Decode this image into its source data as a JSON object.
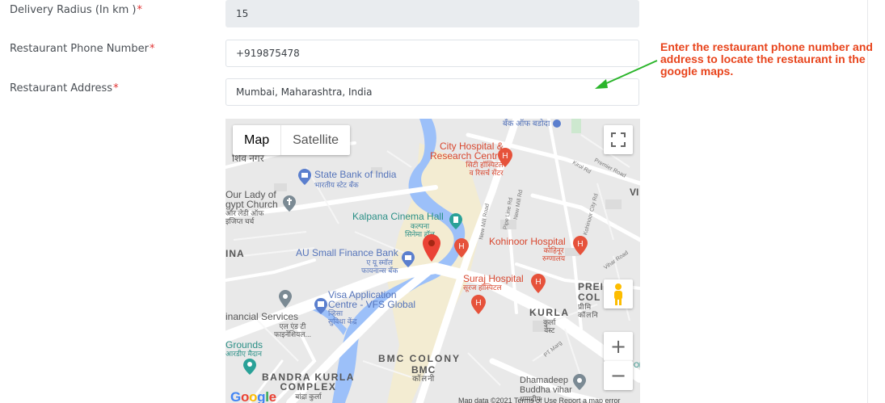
{
  "form": {
    "delivery_radius": {
      "label": "Delivery Radius (In km )",
      "required": "*",
      "value": "15"
    },
    "phone": {
      "label": "Restaurant Phone Number",
      "required": "*",
      "value": "+919875478"
    },
    "address": {
      "label": "Restaurant Address",
      "required": "*",
      "value": "Mumbai, Maharashtra, India"
    }
  },
  "annotation": {
    "text": "Enter the restaurant phone number and address to locate the restaurant in the google maps.",
    "color": "#e8441c",
    "arrow_color": "#2bb52b"
  },
  "map": {
    "type_map": "Map",
    "type_satellite": "Satellite",
    "labels": {
      "bank_baroda": "बँक ऑफ बडोदा",
      "shiv_nagar": "शिव नगर",
      "city_hospital_1": "City Hospital &",
      "city_hospital_2": "Research Centre",
      "city_hospital_3": "सिटी हॉस्पिटल",
      "city_hospital_4": "व रिसर्च सेंटर",
      "sbi_1": "State Bank of India",
      "sbi_2": "भारतीय स्टेट बँक",
      "lady_1": "Our Lady of",
      "lady_2": "gypt Church",
      "lady_3": "ऑर लेडी ऑफ",
      "lady_4": "इजिप्त चर्च",
      "kalpana_1": "Kalpana Cinema Hall",
      "kalpana_2": "कल्पना",
      "kalpana_3": "सिनेमा हॉल",
      "kohinoor_1": "Kohinoor Hospital",
      "kohinoor_2": "कोहिनूर",
      "kohinoor_3": "रुग्णालय",
      "au_1": "AU Small Finance Bank",
      "au_2": "ए यू स्मॉल",
      "au_3": "फायनान्स बँक",
      "ina": "INA",
      "suraj_1": "Suraj Hospital",
      "suraj_2": "सूरज हॉस्पिटल",
      "prem_1": "PREI",
      "prem_2": "COL",
      "prem_3": "प्रीमि",
      "prem_4": "कॉलनि",
      "visa_1": "Visa Application",
      "visa_2": "Centre - VFS Global",
      "visa_3": "व्हिसा",
      "visa_4": "सुविधा केंद्र",
      "fin_1": "inancial Services",
      "fin_2": "एल एंड टी",
      "fin_3": "फाइनेंशियल...",
      "kurla_1": "KURLA",
      "kurla_2": "कुर्ला",
      "kurla_3": "वेस्ट",
      "grounds_1": "Grounds",
      "grounds_2": "आरडीए मैदान",
      "bmc_colony": "BMC COLONY",
      "bmc_1": "BMC",
      "bmc_2": "कॉलनी",
      "bkc_1": "BANDRA KURLA",
      "bkc_2": "COMPLEX",
      "bkc_3": "बांद्रा कुर्ला",
      "dham_1": "Dhamadeep",
      "dham_2": "Buddha vihar",
      "dham_3": "धम्मदीप",
      "vi": "VI",
      "okl": "Ok",
      "roads": {
        "kirol": "Kirol Rd",
        "premier": "Premier Road",
        "new_mill": "New Mill Rd",
        "new_mill2": "New Mill Road",
        "pipe_line": "Pipe Line Rd",
        "kohinoor_city": "Kohinoor City Rd",
        "vihar": "Vihar Road",
        "pt_marg": "PT Marg"
      }
    },
    "google": "Google",
    "attribution": "Map data ©2021   Terms of Use   Report a map error"
  },
  "colors": {
    "hospital": "#e6523b",
    "poi_blue": "#5b7fce",
    "water": "#9cc0f9",
    "label_blue": "#5574ba",
    "label_teal": "#2a8f86",
    "label_dark": "#555555"
  }
}
